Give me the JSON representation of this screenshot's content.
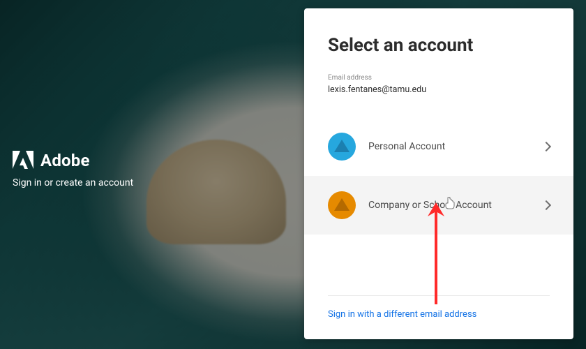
{
  "brand": {
    "name": "Adobe",
    "tagline": "Sign in or create an account"
  },
  "card": {
    "title": "Select an account",
    "email_label": "Email address",
    "email_value": "lexis.fentanes@tamu.edu",
    "options": [
      {
        "label": "Personal Account",
        "icon": "blue"
      },
      {
        "label": "Company or School Account",
        "icon": "orange"
      }
    ],
    "alt_link": "Sign in with a different email address"
  },
  "annotation": {
    "arrow_color": "#ff2a2a"
  }
}
